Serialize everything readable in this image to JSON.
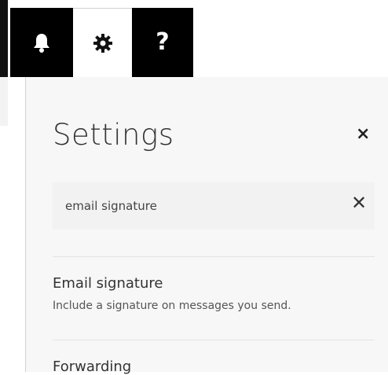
{
  "topbar": {
    "buttons": [
      {
        "icon": "bell-icon"
      },
      {
        "icon": "gear-icon"
      },
      {
        "icon": "help-icon",
        "glyph": "?"
      }
    ]
  },
  "settings": {
    "title": "Settings",
    "close_glyph": "×",
    "search": {
      "value": "email signature",
      "clear_glyph": "✕"
    },
    "results": [
      {
        "title": "Email signature",
        "description": "Include a signature on messages you send."
      },
      {
        "title": "Forwarding",
        "description": ""
      }
    ]
  }
}
